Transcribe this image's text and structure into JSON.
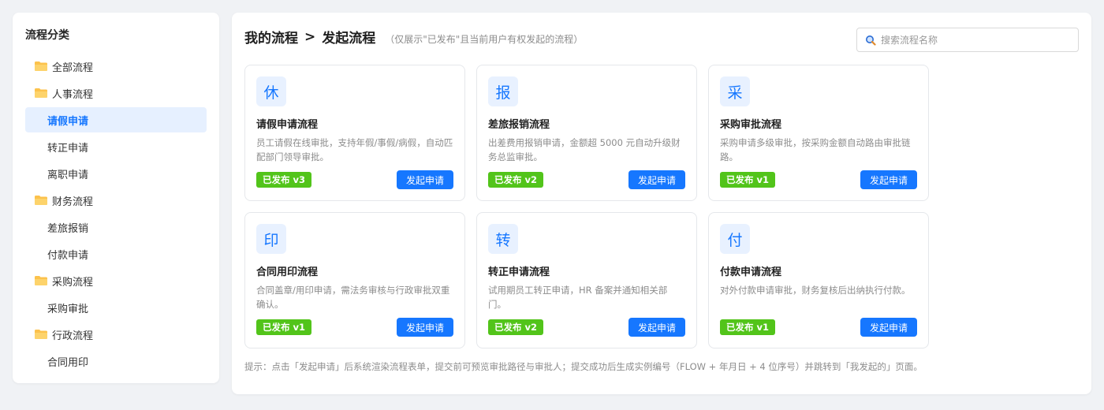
{
  "sidebar": {
    "title": "流程分类",
    "items": [
      {
        "label": "全部流程",
        "type": "group"
      },
      {
        "label": "人事流程",
        "type": "group"
      },
      {
        "label": "请假申请",
        "type": "child",
        "active": true
      },
      {
        "label": "转正申请",
        "type": "child"
      },
      {
        "label": "离职申请",
        "type": "child"
      },
      {
        "label": "财务流程",
        "type": "group"
      },
      {
        "label": "差旅报销",
        "type": "child"
      },
      {
        "label": "付款申请",
        "type": "child"
      },
      {
        "label": "采购流程",
        "type": "group"
      },
      {
        "label": "采购审批",
        "type": "child"
      },
      {
        "label": "行政流程",
        "type": "group"
      },
      {
        "label": "合同用印",
        "type": "child"
      }
    ]
  },
  "header": {
    "crumb1": "我的流程",
    "sep": ">",
    "crumb2": "发起流程",
    "subtitle": "（仅展示\"已发布\"且当前用户有权发起的流程）"
  },
  "search": {
    "placeholder": "搜索流程名称",
    "value": ""
  },
  "cards": [
    {
      "icon": "休",
      "title": "请假申请流程",
      "desc": "员工请假在线审批，支持年假/事假/病假，自动匹配部门领导审批。",
      "badge": "已发布 v3",
      "button": "发起申请"
    },
    {
      "icon": "报",
      "title": "差旅报销流程",
      "desc": "出差费用报销申请，金额超 5000 元自动升级财务总监审批。",
      "badge": "已发布 v2",
      "button": "发起申请"
    },
    {
      "icon": "采",
      "title": "采购审批流程",
      "desc": "采购申请多级审批，按采购金额自动路由审批链路。",
      "badge": "已发布 v1",
      "button": "发起申请"
    },
    {
      "icon": "印",
      "title": "合同用印流程",
      "desc": "合同盖章/用印申请，需法务审核与行政审批双重确认。",
      "badge": "已发布 v1",
      "button": "发起申请"
    },
    {
      "icon": "转",
      "title": "转正申请流程",
      "desc": "试用期员工转正申请，HR 备案并通知相关部门。",
      "badge": "已发布 v2",
      "button": "发起申请"
    },
    {
      "icon": "付",
      "title": "付款申请流程",
      "desc": "对外付款申请审批，财务复核后出纳执行付款。",
      "badge": "已发布 v1",
      "button": "发起申请"
    }
  ],
  "tip": "提示：点击「发起申请」后系统渲染流程表单，提交前可预览审批路径与审批人；提交成功后生成实例编号（FLOW + 年月日 + 4 位序号）并跳转到「我发起的」页面。",
  "colors": {
    "primary": "#1677ff",
    "success": "#52c41a",
    "folder": "#fcc24c",
    "active_bg": "#e6f0ff"
  }
}
